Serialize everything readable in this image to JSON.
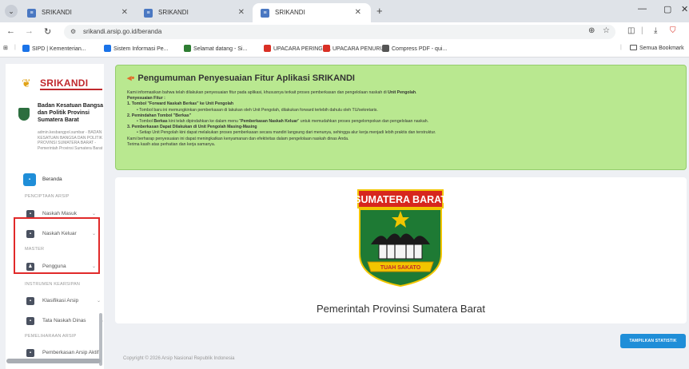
{
  "browser": {
    "tabs": [
      {
        "title": "SRIKANDI",
        "active": false
      },
      {
        "title": "SRIKANDI",
        "active": false
      },
      {
        "title": "SRIKANDI",
        "active": true
      }
    ],
    "url": "srikandi.arsip.go.id/beranda",
    "bookmarks": [
      {
        "label": "SIPD | Kementerian...",
        "color": "#1a73e8"
      },
      {
        "label": "Sistem Informasi Pe...",
        "color": "#1a73e8"
      },
      {
        "label": "Selamat datang - Si...",
        "color": "#2e7d32"
      },
      {
        "label": "UPACARA PERINGA...",
        "color": "#d93025"
      },
      {
        "label": "UPACARA PENURU...",
        "color": "#d93025"
      },
      {
        "label": "Compress PDF - qui...",
        "color": "#555555"
      }
    ],
    "all_bookmarks": "Semua Bookmark"
  },
  "sidebar": {
    "logo": "SRIKANDI",
    "org_name": "Badan Kesatuan Bangsa dan Politik Provinsi Sumatera Barat",
    "org_detail": "admin.kesbangpol.sumbar - BADAN KESATUAN BANGSA DAN POLITIK PROVINSI SUMATERA BARAT - Pemerintah Provinsi Sumatera Barat",
    "beranda": "Beranda",
    "section_penciptaan": "PENCIPTAAN ARSIP",
    "naskah_masuk": "Naskah Masuk",
    "naskah_keluar": "Naskah Keluar",
    "section_master": "MASTER",
    "pengguna": "Pengguna",
    "section_instrumen": "INSTRUMEN KEARSIPAN",
    "klasifikasi": "Klasifikasi Arsip",
    "tata_naskah": "Tata Naskah Dinas",
    "section_pemeliharaan": "PEMELIHARAAN ARSIP",
    "pemberkasan": "Pemberkasan Arsip Aktif"
  },
  "announcement": {
    "title": "Pengumuman Penyesuaian Fitur Aplikasi SRIKANDI",
    "intro_a": "Kami informasikan bahwa telah dilakukan penyesuaian fitur pada aplikasi, khususnya terkait proses pemberkasan dan pengelolaan naskah di ",
    "intro_b": "Unit Pengolah",
    "penyesuaian": "Penyesuaian Fitur :",
    "item1_title": "1. Tombol \"Forward Naskah Berkas\" ke Unit Pengolah",
    "item1_detail": "• Tombol baru ini memungkinkan pemberkasan di lakukan oleh Unit Pengolah, dilakukan forward terlebih dahulu oleh TU/sekretaris.",
    "item2_title": "2. Pemindahan Tombol \"Berkas\"",
    "item2_detail_a": "• Tombol ",
    "item2_detail_b": "Berkas",
    "item2_detail_c": " kini telah dipindahkan ke dalam menu \"",
    "item2_detail_d": "Pemberkasan Naskah Keluar",
    "item2_detail_e": "\" untuk memudahkan proses pengelompokan dan pengelolaan naskah.",
    "item3_title": "3. Pemberkasan Dapat Dilakukan di Unit Pengolah Masing-Masing",
    "item3_detail": "• Setiap Unit Pengolah kini dapat melakukan proses pemberkasan secara mandiri langsung dari menunya, sehingga alur kerja menjadi lebih praktis dan terstruktur.",
    "closing1": "Kami berharap penyesuaian ini dapat meningkatkan kenyamanan dan efektivitas dalam pengelolaan naskah dinas Anda.",
    "closing2": "Terima kasih atas perhatian dan kerja samanya."
  },
  "emblem": {
    "banner": "SUMATERA BARAT",
    "ribbon": "TUAH SAKATO",
    "colors": {
      "banner": "#d7261e",
      "shield": "#1e7a34",
      "gold": "#f2c500"
    }
  },
  "province_name": "Pemerintah Provinsi Sumatera Barat",
  "stat_button": "TAMPILKAN STATISTIK",
  "copyright": "Copyright © 2026 Arsip Nasional Republik Indonesia"
}
